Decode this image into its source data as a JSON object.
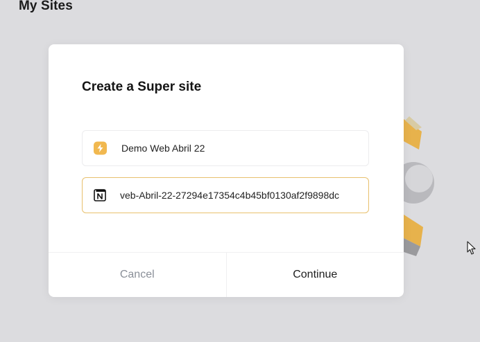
{
  "page": {
    "title": "My Sites"
  },
  "modal": {
    "title": "Create a Super site",
    "site_name": {
      "icon": "lightning-bolt-icon",
      "value": "Demo Web Abril 22"
    },
    "notion_url": {
      "icon": "notion-logo-icon",
      "value": "veb-Abril-22-27294e17354c4b45bf0130af2f9898dc"
    },
    "cancel_label": "Cancel",
    "continue_label": "Continue"
  },
  "colors": {
    "accent": "#f1b84f",
    "active_border": "#e8c06d",
    "cancel_text": "#8a8f98",
    "background": "#dcdcdf"
  }
}
